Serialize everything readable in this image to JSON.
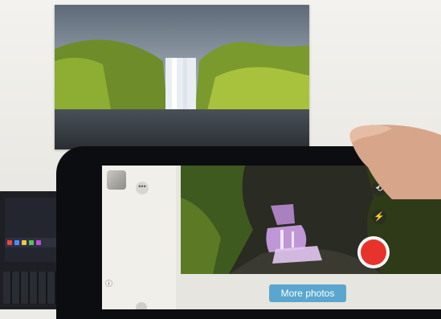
{
  "laptop_bar_colors": [
    "#e44",
    "#4a8cff",
    "#f5c542",
    "#5ac05a",
    "#c04bd6"
  ],
  "tablet_app": {
    "more_photos_label": "More photos",
    "menu_icon": "more-dots-icon",
    "switch_camera_icon": "camera-switch-icon",
    "flash_icon": "flash-icon",
    "record_color": "#e8332c"
  }
}
